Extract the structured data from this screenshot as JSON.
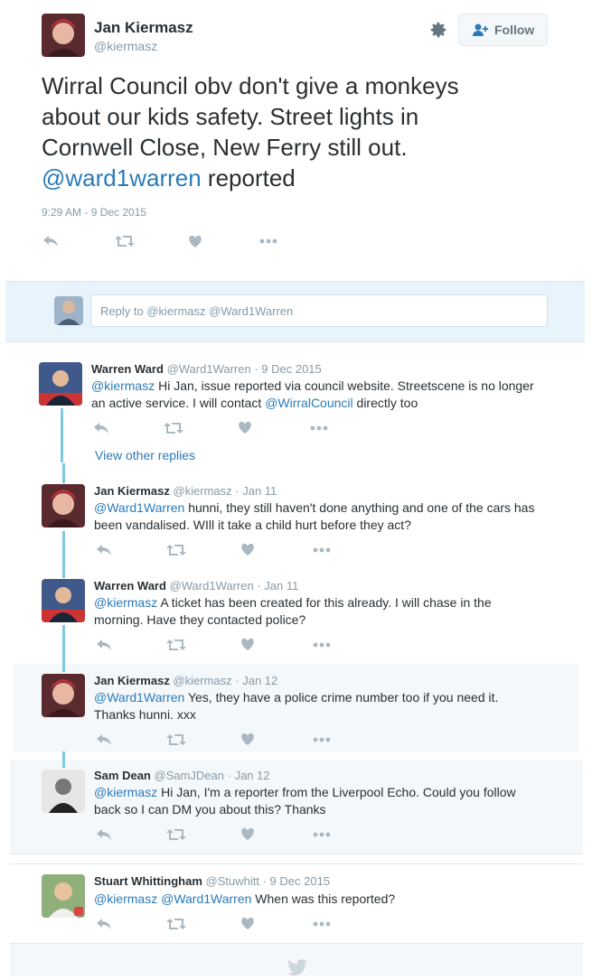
{
  "tweet": {
    "author_name": "Jan Kiermasz",
    "author_handle": "@kiermasz",
    "follow_label": "Follow",
    "text_line1": "Wirral Council obv don't give a monkeys",
    "text_line2": "about our kids safety. Street lights in",
    "text_line3": "Cornwell Close, New Ferry still out.",
    "text_mention": "@ward1warren",
    "text_end": " reported",
    "timestamp": "9:29 AM - 9 Dec 2015",
    "icons": [
      "reply-icon",
      "retweet-icon",
      "like-icon",
      "more-icon",
      "gear-icon",
      "follow-person-icon"
    ]
  },
  "reply_box": {
    "placeholder": "Reply to @kiermasz @Ward1Warren"
  },
  "view_other_replies": "View other replies",
  "replies": [
    {
      "name": "Warren Ward",
      "handle": "@Ward1Warren",
      "date": "· 9 Dec 2015",
      "mention": "@kiermasz",
      "text": " Hi Jan, issue reported via council website. Streetscene is no longer",
      "text2a": "an active service. I will contact ",
      "mention2": "@WirralCouncil",
      "text2b": " directly too"
    },
    {
      "name": "Jan Kiermasz",
      "handle": "@kiermasz",
      "date": "· Jan 11",
      "mention": "@Ward1Warren",
      "text": " hunni, they still haven't done anything and one of the cars has",
      "text2": "been vandalised. WIll it take a child hurt before they act?"
    },
    {
      "name": "Warren Ward",
      "handle": "@Ward1Warren",
      "date": "· Jan 11",
      "mention": "@kiermasz",
      "text": " A ticket has been created for this already. I will chase in the",
      "text2": "morning. Have they contacted police?"
    },
    {
      "name": "Jan Kiermasz",
      "handle": "@kiermasz",
      "date": "· Jan 12",
      "mention": "@Ward1Warren",
      "text": " Yes, they have a police crime number too if you need it.",
      "text2": "Thanks hunni. xxx"
    },
    {
      "name": "Sam Dean",
      "handle": "@SamJDean",
      "date": "· Jan 12",
      "mention": "@kiermasz",
      "text": " Hi Jan, I'm a reporter from the Liverpool Echo. Could you follow",
      "text2": "back so I can DM you about this? Thanks"
    },
    {
      "name": "Stuart Whittingham",
      "handle": "@Stuwhitt",
      "date": "· 9 Dec 2015",
      "mention": "@kiermasz",
      "mention2": " @Ward1Warren",
      "text": " When was this reported?"
    }
  ],
  "colors": {
    "link": "#2b7bb9",
    "muted": "#8899a6",
    "thread_line": "#7ec8e3",
    "reply_band": "#f5f8fa"
  }
}
